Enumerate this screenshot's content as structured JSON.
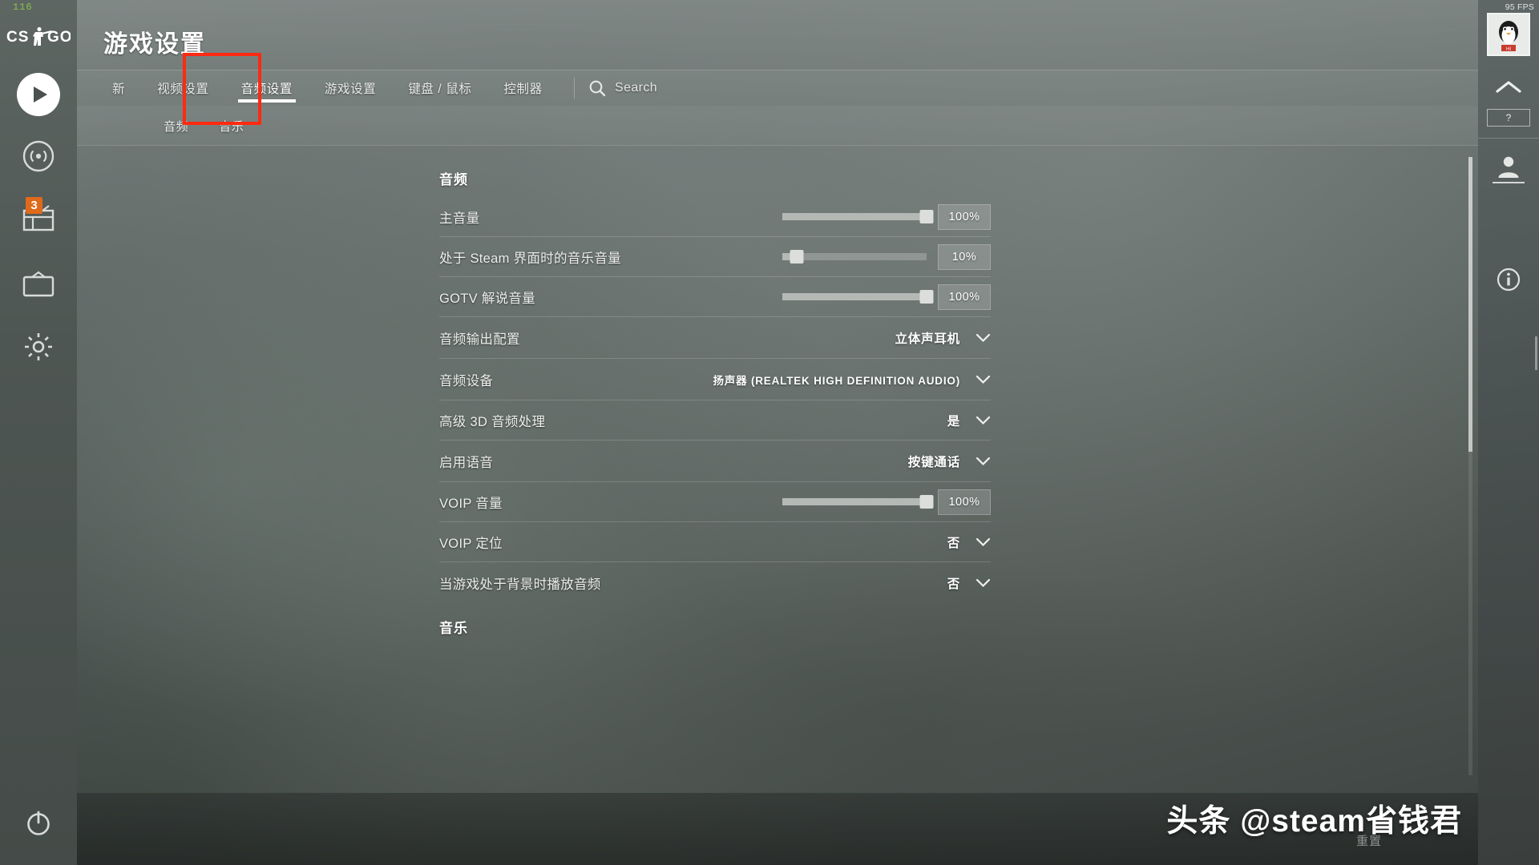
{
  "window": {
    "title": "游戏设置",
    "corner_counter": "116",
    "fps": "95 FPS"
  },
  "left_rail": {
    "logo": "CS:GO",
    "items": [
      {
        "name": "play-button",
        "label": "播放"
      },
      {
        "name": "broadcast-icon",
        "label": "观看"
      },
      {
        "name": "inventory-icon",
        "label": "库存",
        "badge": "3"
      },
      {
        "name": "watch-icon",
        "label": "电视"
      },
      {
        "name": "settings-gear-icon",
        "label": "设置"
      }
    ],
    "power_label": "退出"
  },
  "tabs": [
    {
      "label": "新",
      "active": false
    },
    {
      "label": "视频设置",
      "active": false
    },
    {
      "label": "音频设置",
      "active": true
    },
    {
      "label": "游戏设置",
      "active": false
    },
    {
      "label": "键盘 / 鼠标",
      "active": false
    },
    {
      "label": "控制器",
      "active": false
    }
  ],
  "search": {
    "placeholder": "Search",
    "value": "",
    "icon": "search-icon"
  },
  "subtabs": [
    {
      "label": "音频",
      "active": true
    },
    {
      "label": "音乐",
      "active": false
    }
  ],
  "sections": [
    {
      "title": "音频",
      "rows": [
        {
          "type": "slider",
          "label": "主音量",
          "value": "100%",
          "percent": 100
        },
        {
          "type": "slider",
          "label": "处于 Steam 界面时的音乐音量",
          "value": "10%",
          "percent": 10
        },
        {
          "type": "slider",
          "label": "GOTV 解说音量",
          "value": "100%",
          "percent": 100
        },
        {
          "type": "dropdown",
          "label": "音频输出配置",
          "value": "立体声耳机"
        },
        {
          "type": "dropdown",
          "label": "音频设备",
          "value": "扬声器 (REALTEK HIGH DEFINITION AUDIO)"
        },
        {
          "type": "dropdown",
          "label": "高级 3D 音频处理",
          "value": "是"
        },
        {
          "type": "dropdown",
          "label": "启用语音",
          "value": "按键通话"
        },
        {
          "type": "slider",
          "label": "VOIP 音量",
          "value": "100%",
          "percent": 100
        },
        {
          "type": "dropdown",
          "label": "VOIP 定位",
          "value": "否"
        },
        {
          "type": "dropdown",
          "label": "当游戏处于背景时播放音频",
          "value": "否"
        }
      ]
    },
    {
      "title": "音乐",
      "rows": []
    }
  ],
  "steam_overlay": {
    "help_label": "?",
    "buttons": [
      {
        "name": "avatar",
        "label": "头像"
      },
      {
        "name": "collapse-chevron-icon",
        "label": "收起"
      },
      {
        "name": "help-button",
        "label": "?"
      },
      {
        "name": "profile-icon",
        "label": "个人资料"
      },
      {
        "name": "info-icon",
        "label": "信息"
      }
    ]
  },
  "watermark": {
    "text": "头条 @steam省钱君",
    "subtext": "重置"
  },
  "colors": {
    "highlight_box": "#ff2a11",
    "badge": "#e06a1b",
    "accent_white": "#ffffff",
    "fps_green": "#89c04a"
  }
}
